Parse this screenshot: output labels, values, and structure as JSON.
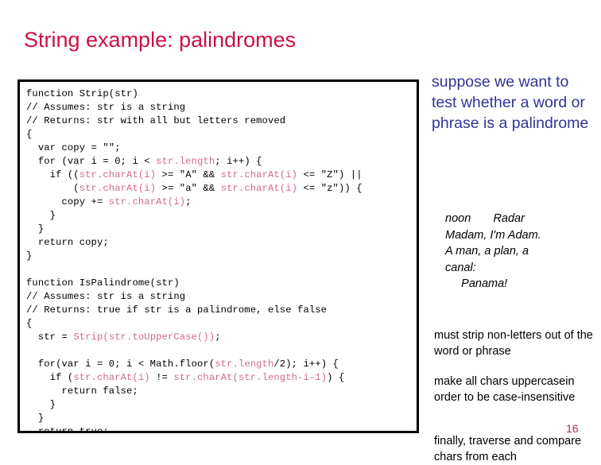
{
  "slide": {
    "title": "String example: palindromes",
    "page_number": "16",
    "title_color": "#cc1144",
    "lead_color": "#333399",
    "code_highlight_color": "#d16a86"
  },
  "code": {
    "language": "javascript",
    "lines": [
      [
        {
          "t": "function Strip(str)",
          "hl": false
        }
      ],
      [
        {
          "t": "// Assumes: str is a string",
          "hl": false
        }
      ],
      [
        {
          "t": "// Returns: str with all but letters removed",
          "hl": false
        }
      ],
      [
        {
          "t": "{",
          "hl": false
        }
      ],
      [
        {
          "t": "  var copy = \"\";",
          "hl": false
        }
      ],
      [
        {
          "t": "  for (var i = 0; i < ",
          "hl": false
        },
        {
          "t": "str.length",
          "hl": true
        },
        {
          "t": "; i++) {",
          "hl": false
        }
      ],
      [
        {
          "t": "    if ((",
          "hl": false
        },
        {
          "t": "str.charAt(i)",
          "hl": true
        },
        {
          "t": " >= \"A\" && ",
          "hl": false
        },
        {
          "t": "str.charAt(i)",
          "hl": true
        },
        {
          "t": " <= \"Z\") ||",
          "hl": false
        }
      ],
      [
        {
          "t": "        (",
          "hl": false
        },
        {
          "t": "str.charAt(i)",
          "hl": true
        },
        {
          "t": " >= \"a\" && ",
          "hl": false
        },
        {
          "t": "str.charAt(i)",
          "hl": true
        },
        {
          "t": " <= \"z\")) {",
          "hl": false
        }
      ],
      [
        {
          "t": "      copy += ",
          "hl": false
        },
        {
          "t": "str.charAt(i)",
          "hl": true
        },
        {
          "t": ";",
          "hl": false
        }
      ],
      [
        {
          "t": "    }",
          "hl": false
        }
      ],
      [
        {
          "t": "  }",
          "hl": false
        }
      ],
      [
        {
          "t": "  return copy;",
          "hl": false
        }
      ],
      [
        {
          "t": "}",
          "hl": false
        }
      ],
      [
        {
          "t": "",
          "hl": false
        }
      ],
      [
        {
          "t": "function IsPalindrome(str)",
          "hl": false
        }
      ],
      [
        {
          "t": "// Assumes: str is a string",
          "hl": false
        }
      ],
      [
        {
          "t": "// Returns: true if str is a palindrome, else false",
          "hl": false
        }
      ],
      [
        {
          "t": "{",
          "hl": false
        }
      ],
      [
        {
          "t": "  str = ",
          "hl": false
        },
        {
          "t": "Strip(str.toUpperCase())",
          "hl": true
        },
        {
          "t": ";",
          "hl": false
        }
      ],
      [
        {
          "t": "",
          "hl": false
        }
      ],
      [
        {
          "t": "  for(var i = 0; i < Math.floor(",
          "hl": false
        },
        {
          "t": "str.length",
          "hl": true
        },
        {
          "t": "/2); i++) {",
          "hl": false
        }
      ],
      [
        {
          "t": "    if (",
          "hl": false
        },
        {
          "t": "str.charAt(i)",
          "hl": true
        },
        {
          "t": " != ",
          "hl": false
        },
        {
          "t": "str.charAt(str.length-i-1)",
          "hl": true
        },
        {
          "t": ") {",
          "hl": false
        }
      ],
      [
        {
          "t": "      return false;",
          "hl": false
        }
      ],
      [
        {
          "t": "    }",
          "hl": false
        }
      ],
      [
        {
          "t": "  }",
          "hl": false
        }
      ],
      [
        {
          "t": "  return true;",
          "hl": false
        }
      ],
      [
        {
          "t": "}",
          "hl": false
        }
      ]
    ]
  },
  "rail": {
    "lead": "suppose we want to test whether a word or phrase is a palindrome",
    "examples": "noon       Radar\nMadam, I'm Adam.\nA man, a plan, a\ncanal:\n     Panama!",
    "note_1": "must strip non-letters out of the word or phrase",
    "note_2": "make all chars uppercasein order to be case-insensitive",
    "note_3": "finally, traverse and compare chars from each"
  }
}
